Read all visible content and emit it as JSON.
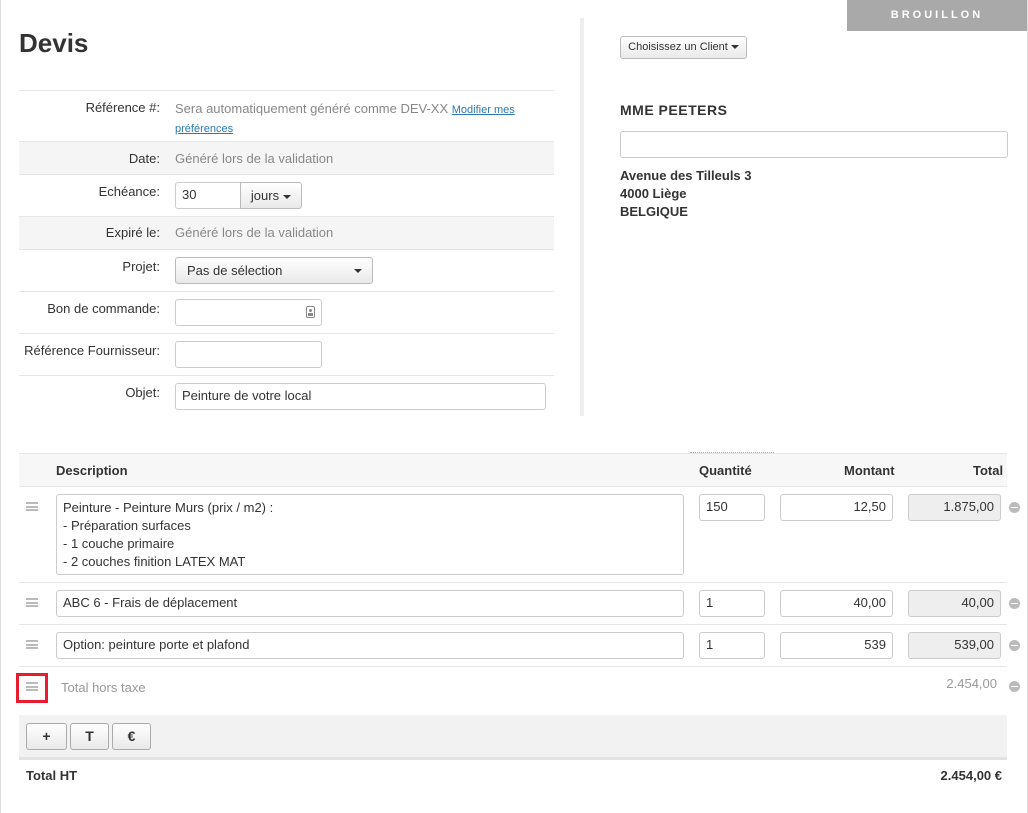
{
  "status_badge": "BROUILLON",
  "page_title": "Devis",
  "form": {
    "reference_label": "Référence #:",
    "reference_value": "Sera automatiquement généré comme DEV-XX",
    "reference_link_1": "Modifier mes",
    "reference_link_2": "préférences",
    "date_label": "Date:",
    "date_value": "Généré lors de la validation",
    "echeance_label": "Echéance:",
    "echeance_value": "30",
    "echeance_unit": "jours",
    "expire_label": "Expiré le:",
    "expire_value": "Généré lors de la validation",
    "projet_label": "Projet:",
    "projet_value": "Pas de sélection",
    "bon_label": "Bon de commande:",
    "bon_value": "",
    "ref_fournisseur_label": "Référence Fournisseur:",
    "ref_fournisseur_value": "",
    "objet_label": "Objet:",
    "objet_value": "Peinture de votre local"
  },
  "client": {
    "choose_button": "Choisissez un Client",
    "name": "MME PEETERS",
    "extra_field_value": "",
    "address_line1": "Avenue des Tilleuls 3",
    "address_line2": "4000 Liège",
    "address_line3": "BELGIQUE"
  },
  "lines": {
    "columns": {
      "description": "Description",
      "quantity": "Quantité",
      "amount": "Montant",
      "total": "Total"
    },
    "items": [
      {
        "description": "Peinture - Peinture Murs (prix / m2) :\n- Préparation surfaces\n- 1 couche primaire\n- 2 couches finition LATEX MAT",
        "quantity": "150",
        "amount": "12,50",
        "total": "1.875,00"
      },
      {
        "description": "ABC 6 - Frais de déplacement",
        "quantity": "1",
        "amount": "40,00",
        "total": "40,00"
      },
      {
        "description": "Option: peinture porte et plafond",
        "quantity": "1",
        "amount": "539",
        "total": "539,00"
      }
    ],
    "subtotal_label": "Total hors taxe",
    "subtotal_value": "2.454,00"
  },
  "toolbar": {
    "add_label": "+",
    "text_label": "T",
    "euro_label": "€"
  },
  "footer": {
    "total_label": "Total HT",
    "total_value": "2.454,00 €"
  },
  "colors": {
    "badge": "#a9a9a9",
    "link": "#2a7ab0",
    "highlight": "#e81c2e"
  }
}
